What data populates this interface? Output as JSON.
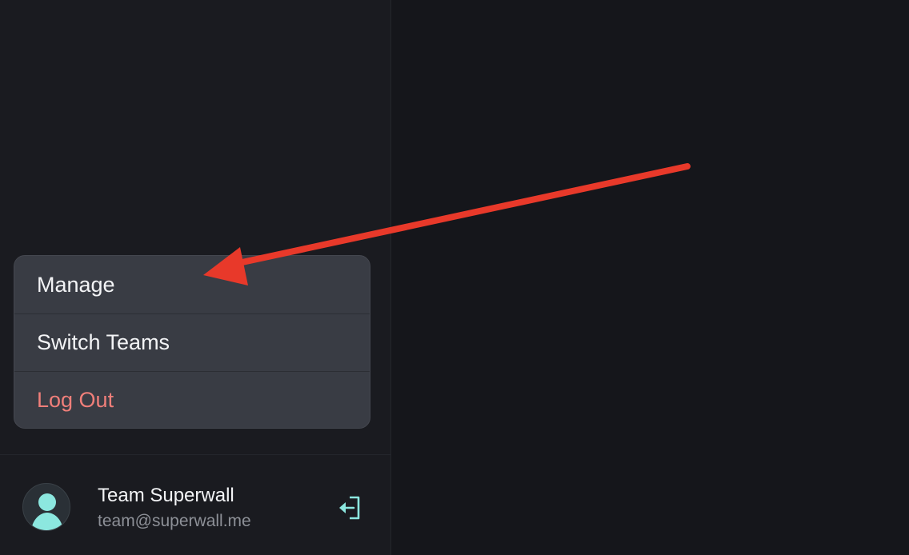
{
  "menu": {
    "items": [
      {
        "label": "Manage"
      },
      {
        "label": "Switch Teams"
      },
      {
        "label": "Log Out"
      }
    ]
  },
  "account": {
    "name": "Team Superwall",
    "email": "team@superwall.me",
    "avatar_icon": "user-avatar-icon",
    "logout_icon": "logout-icon"
  },
  "colors": {
    "accent": "#8ce7df",
    "danger": "#f07f7a",
    "annotation_arrow": "#e8392a"
  }
}
